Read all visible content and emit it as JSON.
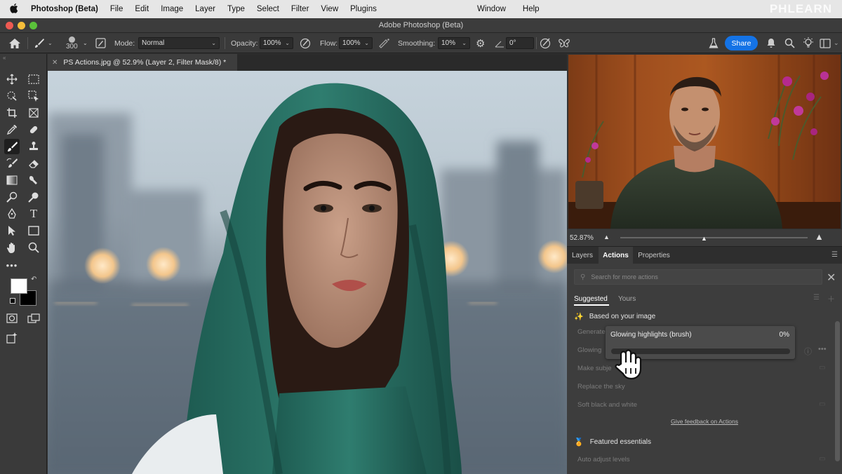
{
  "menubar": {
    "app_name": "Photoshop (Beta)",
    "items": [
      "File",
      "Edit",
      "Image",
      "Layer",
      "Type",
      "Select",
      "Filter",
      "View",
      "Plugins"
    ],
    "right_items": [
      "Window",
      "Help"
    ],
    "watermark": "PHLEARN"
  },
  "titlebar": {
    "title": "Adobe Photoshop (Beta)"
  },
  "options": {
    "brush_size": "300",
    "mode_label": "Mode:",
    "mode_value": "Normal",
    "opacity_label": "Opacity:",
    "opacity_value": "100%",
    "flow_label": "Flow:",
    "flow_value": "100%",
    "smoothing_label": "Smoothing:",
    "smoothing_value": "10%",
    "angle_value": "0°",
    "share_label": "Share"
  },
  "document": {
    "tab_title": "PS Actions.jpg @ 52.9% (Layer 2, Filter Mask/8) *"
  },
  "navigator": {
    "zoom": "52.87%"
  },
  "panel": {
    "tabs": [
      "Layers",
      "Actions",
      "Properties"
    ],
    "active_tab": "Actions",
    "search_placeholder": "Search for more actions",
    "subtabs": [
      "Suggested",
      "Yours"
    ],
    "section_based": "Based on your image",
    "items": [
      "Generate background",
      "Glowing highlights (brush)",
      "Make subject pop",
      "Replace the sky",
      "Soft black and white"
    ],
    "item_visible": [
      "Generate",
      "Glowing",
      "Make subje",
      "Replace the sky",
      "Soft black and white"
    ],
    "feedback_link": "Give feedback on Actions",
    "section_featured": "Featured essentials",
    "featured_items": [
      "Auto adjust levels"
    ],
    "tooltip": {
      "title": "Glowing highlights (brush)",
      "percent": "0%",
      "progress": 0
    }
  }
}
